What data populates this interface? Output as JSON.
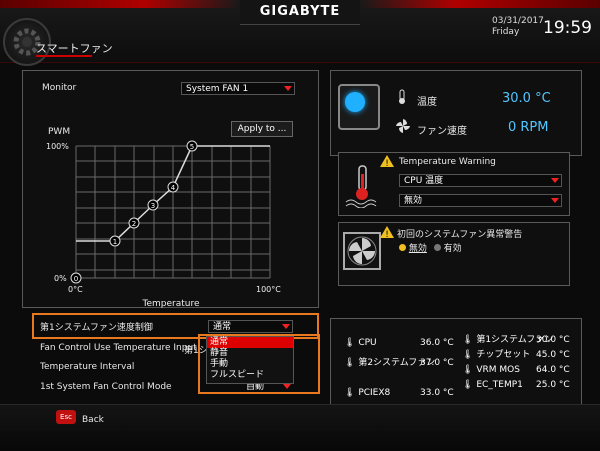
{
  "header": {
    "brand": "GIGABYTE",
    "title": "スマートファン",
    "date": "03/31/2017",
    "day": "Friday",
    "time": "19:59"
  },
  "left": {
    "monitor_label": "Monitor",
    "monitor_value": "System FAN 1",
    "pwm_label": "PWM",
    "apply_label": "Apply to ...",
    "y_top": "100%",
    "y_bottom": "0%",
    "x_left": "0°C",
    "x_right": "100°C",
    "x_axis": "Temperature",
    "points": [
      "0",
      "1",
      "2",
      "3",
      "4",
      "5"
    ],
    "settings": [
      {
        "label": "第1システムファン速度制御",
        "value": "通常"
      },
      {
        "label": "Fan Control Use Temperature Input",
        "value": "第1シ..."
      },
      {
        "label": "Temperature Interval",
        "value": ""
      },
      {
        "label": "1st System Fan Control Mode",
        "value": "自動"
      }
    ],
    "options": [
      "通常",
      "静音",
      "手動",
      "フルスピード"
    ]
  },
  "status": {
    "temp_label": "温度",
    "temp_value": "30.0 °C",
    "fan_label": "ファン速度",
    "fan_value": "0 RPM"
  },
  "warning": {
    "title": "Temperature Warning",
    "source": "CPU 温度",
    "value": "無効"
  },
  "fanfail": {
    "title": "初回のシステムファン異常警告",
    "off": "無効",
    "on": "有効"
  },
  "sensors": {
    "left": [
      {
        "name": "CPU",
        "value": "36.0 °C"
      },
      {
        "name": "第2システムファン",
        "value": "37.0 °C"
      },
      {
        "name": "PCIEX8",
        "value": "33.0 °C"
      }
    ],
    "right": [
      {
        "name": "第1システムファン",
        "value": "30.0 °C"
      },
      {
        "name": "チップセット",
        "value": "45.0 °C"
      },
      {
        "name": "VRM MOS",
        "value": "64.0 °C"
      },
      {
        "name": "EC_TEMP1",
        "value": "25.0 °C"
      }
    ]
  },
  "footer": {
    "esc": "Esc",
    "back": "Back"
  },
  "colors": {
    "accent": "#cc0000",
    "highlight": "#e8791e",
    "sensor_value": "#52c6ff"
  }
}
